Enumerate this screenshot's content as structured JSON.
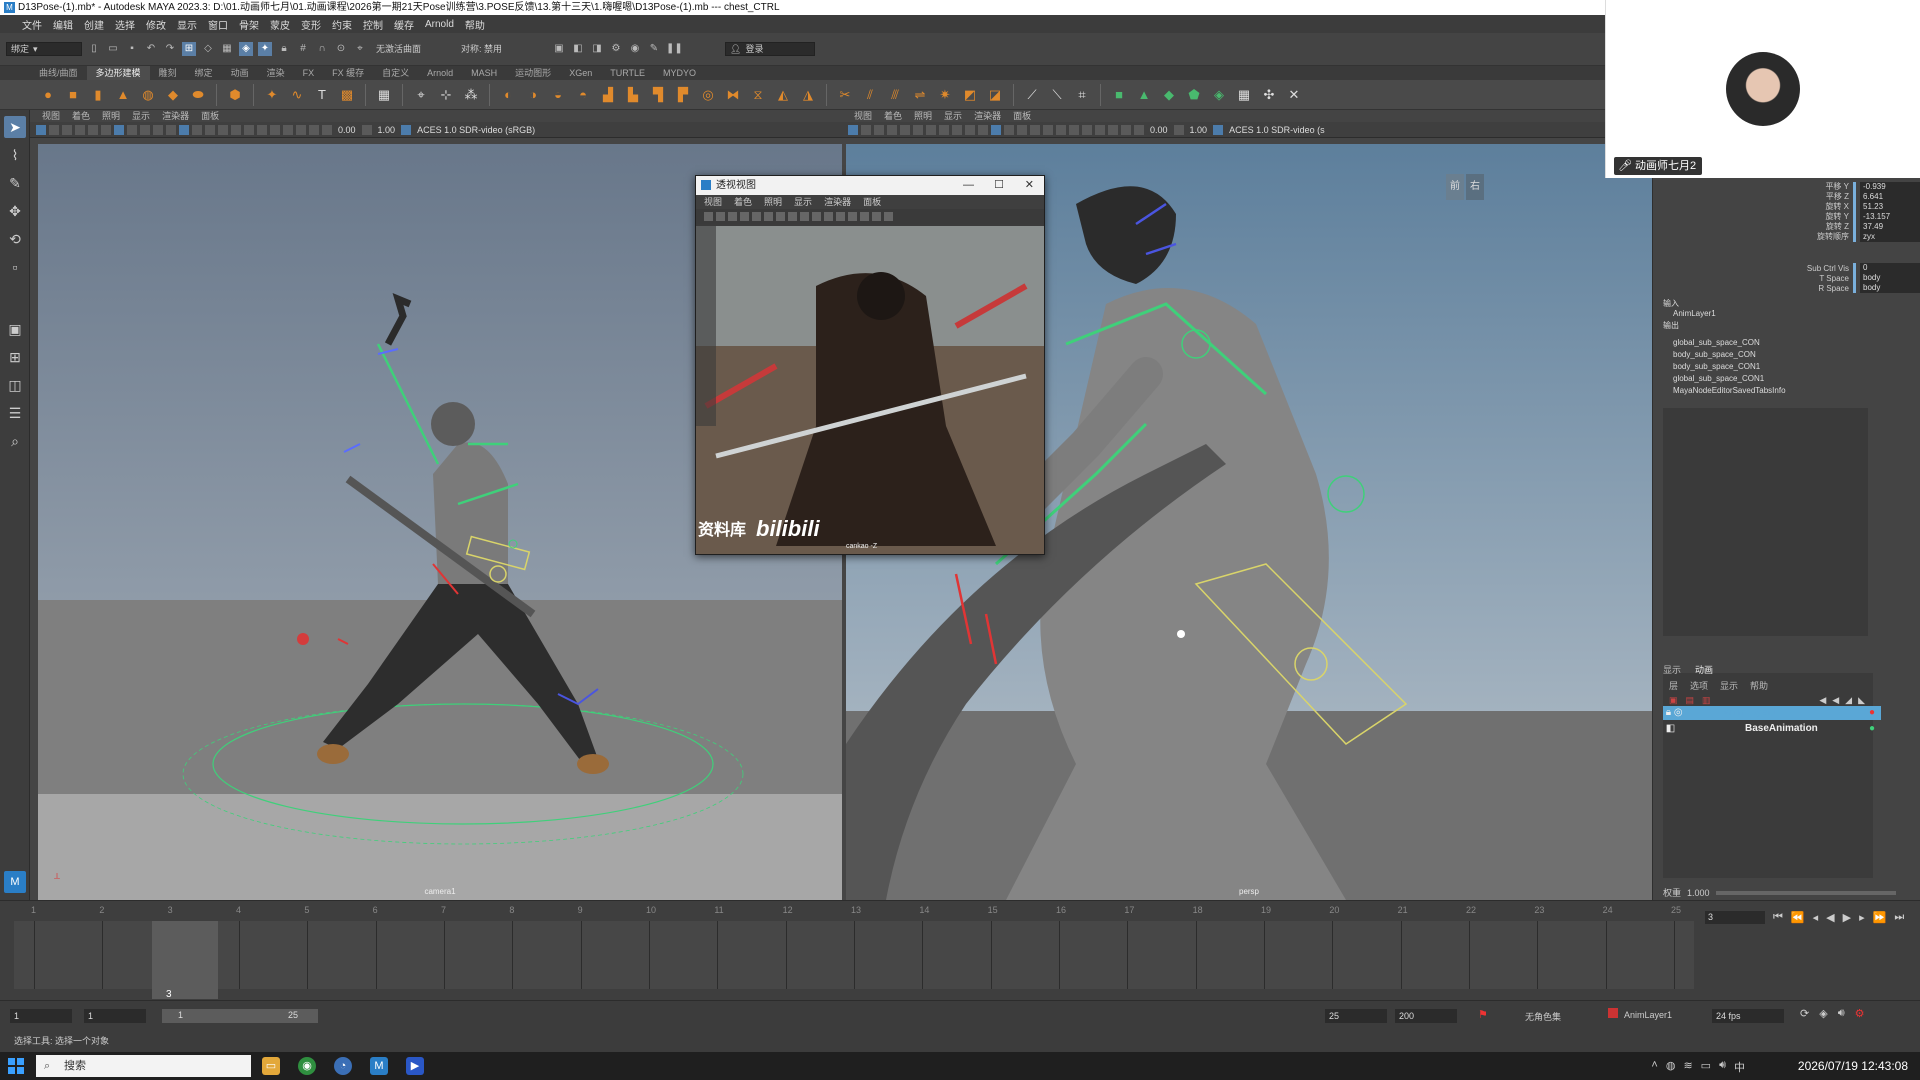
{
  "window": {
    "title": "D13Pose-(1).mb* - Autodesk MAYA 2023.3: D:\\01.动画师七月\\01.动画课程\\2026第一期21天Pose训练营\\3.POSE反馈\\13.第十三天\\1.嗨喔嗯\\D13Pose-(1).mb  ---  chest_CTRL"
  },
  "menubar": [
    "文件",
    "编辑",
    "创建",
    "选择",
    "修改",
    "显示",
    "窗口",
    "骨架",
    "蒙皮",
    "变形",
    "约束",
    "控制",
    "缓存",
    "Arnold",
    "帮助"
  ],
  "status": {
    "mode": "绑定",
    "live_surface": "无激活曲面",
    "symmetry": "对称: 禁用",
    "login": "登录"
  },
  "shelf_tabs": {
    "items": [
      "曲线/曲面",
      "多边形建模",
      "雕刻",
      "绑定",
      "动画",
      "渲染",
      "FX",
      "FX 缓存",
      "自定义",
      "Arnold",
      "MASH",
      "运动图形",
      "XGen",
      "TURTLE",
      "MYDYO"
    ],
    "active": 1
  },
  "viewport_menu": [
    "视图",
    "着色",
    "照明",
    "显示",
    "渲染器",
    "面板"
  ],
  "viewport_left": {
    "camera": "camera1",
    "exposure": "0.00",
    "gamma": "1.00",
    "color_space": "ACES 1.0 SDR-video (sRGB)"
  },
  "viewport_right": {
    "camera": "persp",
    "exposure": "0.00",
    "gamma": "1.00",
    "color_space": "ACES 1.0 SDR-video (s"
  },
  "float_window": {
    "title": "透视视图",
    "menu": [
      "视图",
      "着色",
      "照明",
      "显示",
      "渲染器",
      "面板"
    ],
    "video_watermark_a": "资料库",
    "video_watermark_b": "bilibili",
    "camera": "cankao -Z"
  },
  "webcam": {
    "name": "动画师七月2"
  },
  "channel_box": {
    "attrs": [
      {
        "key": "平移 Y",
        "value": "-0.939"
      },
      {
        "key": "平移 Z",
        "value": "6.641"
      },
      {
        "key": "旋转 X",
        "value": "51.23"
      },
      {
        "key": "旋转 Y",
        "value": "-13.157"
      },
      {
        "key": "旋转 Z",
        "value": "37.49"
      },
      {
        "key": "旋转顺序",
        "value": "zyx"
      }
    ],
    "extra_attrs": [
      {
        "key": "Sub Ctrl Vis",
        "value": "0"
      },
      {
        "key": "T Space",
        "value": "body"
      },
      {
        "key": "R Space",
        "value": "body"
      }
    ],
    "inputs_label": "输入",
    "inputs": [
      "AnimLayer1"
    ],
    "outputs_label": "输出",
    "outputs": [
      "global_sub_space_CON",
      "body_sub_space_CON",
      "body_sub_space_CON1",
      "global_sub_space_CON1",
      "MayaNodeEditorSavedTabsInfo"
    ]
  },
  "layers": {
    "tabs": [
      "显示",
      "动画"
    ],
    "menu": [
      "层",
      "选项",
      "显示",
      "帮助"
    ],
    "items": [
      "AnimLayer1",
      "BaseAnimation"
    ],
    "weight_label": "权重",
    "weight_value": "1.000"
  },
  "timeline": {
    "frames": [
      "1",
      "2",
      "3",
      "4",
      "5",
      "6",
      "7",
      "8",
      "9",
      "10",
      "11",
      "12",
      "13",
      "14",
      "15",
      "16",
      "17",
      "18",
      "19",
      "20",
      "21",
      "22",
      "23",
      "24",
      "25"
    ],
    "current": "3"
  },
  "range": {
    "start": "1",
    "anim_start": "1",
    "slider_start": "1",
    "slider_end": "25",
    "end": "25",
    "anim_end": "200",
    "char_set": "无角色集",
    "anim_layer": "AnimLayer1",
    "fps": "24 fps"
  },
  "help": "选择工具: 选择一个对象",
  "taskbar": {
    "search": "搜索",
    "datetime": "2026/07/19 12:43:08"
  }
}
